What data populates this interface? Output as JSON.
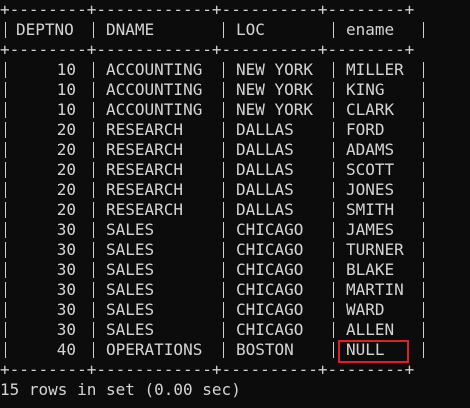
{
  "table": {
    "separator": "+--------+------------+----------+--------+",
    "columns": [
      "DEPTNO",
      "DNAME",
      "LOC",
      "ename"
    ],
    "rows": [
      [
        "10",
        "ACCOUNTING",
        "NEW YORK",
        "MILLER"
      ],
      [
        "10",
        "ACCOUNTING",
        "NEW YORK",
        "KING"
      ],
      [
        "10",
        "ACCOUNTING",
        "NEW YORK",
        "CLARK"
      ],
      [
        "20",
        "RESEARCH",
        "DALLAS",
        "FORD"
      ],
      [
        "20",
        "RESEARCH",
        "DALLAS",
        "ADAMS"
      ],
      [
        "20",
        "RESEARCH",
        "DALLAS",
        "SCOTT"
      ],
      [
        "20",
        "RESEARCH",
        "DALLAS",
        "JONES"
      ],
      [
        "20",
        "RESEARCH",
        "DALLAS",
        "SMITH"
      ],
      [
        "30",
        "SALES",
        "CHICAGO",
        "JAMES"
      ],
      [
        "30",
        "SALES",
        "CHICAGO",
        "TURNER"
      ],
      [
        "30",
        "SALES",
        "CHICAGO",
        "BLAKE"
      ],
      [
        "30",
        "SALES",
        "CHICAGO",
        "MARTIN"
      ],
      [
        "30",
        "SALES",
        "CHICAGO",
        "WARD"
      ],
      [
        "30",
        "SALES",
        "CHICAGO",
        "ALLEN"
      ],
      [
        "40",
        "OPERATIONS",
        "BOSTON",
        "NULL"
      ]
    ]
  },
  "status": "15 rows in set (0.00 sec)",
  "colors": {
    "background": "#0c0c0c",
    "text": "#d4d4d4",
    "highlight_border": "#e02020"
  }
}
